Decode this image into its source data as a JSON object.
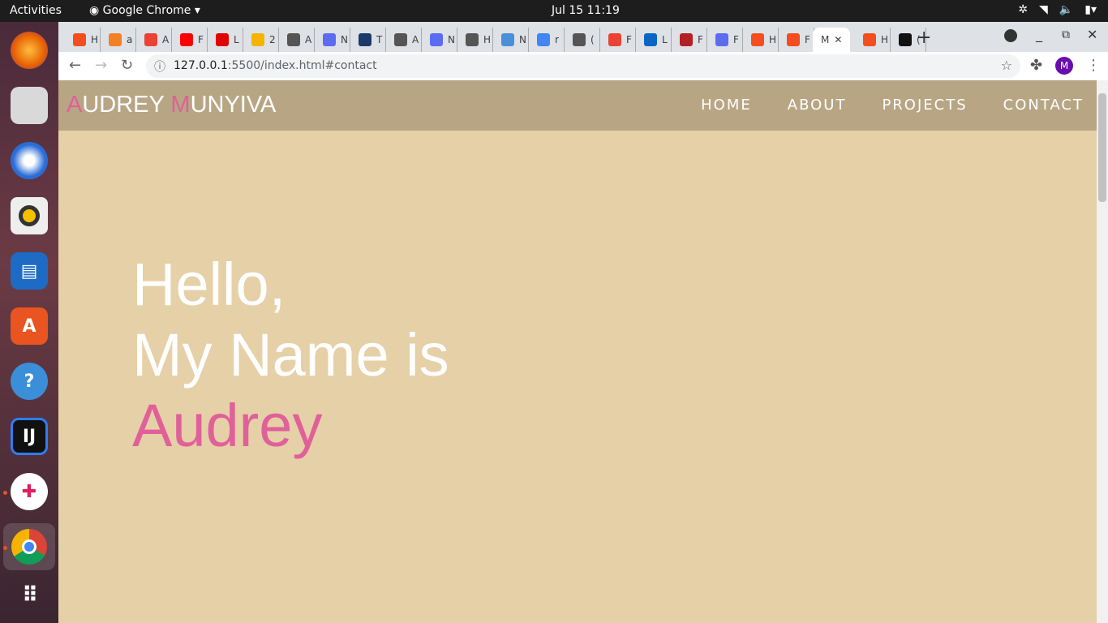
{
  "system": {
    "activities": "Activities",
    "app": "Google Chrome",
    "clock": "Jul 15  11:19"
  },
  "browser": {
    "tabs": [
      {
        "letter": "H",
        "color": "#f24e1e"
      },
      {
        "letter": "a",
        "color": "#f48024"
      },
      {
        "letter": "A",
        "color": "#ea4335"
      },
      {
        "letter": "F",
        "color": "#ff0000"
      },
      {
        "letter": "L",
        "color": "#e00000"
      },
      {
        "letter": "2",
        "color": "#f4b400"
      },
      {
        "letter": "A",
        "color": "#555"
      },
      {
        "letter": "N",
        "color": "#5c6bf0"
      },
      {
        "letter": "T",
        "color": "#1a3a6a"
      },
      {
        "letter": "A",
        "color": "#555"
      },
      {
        "letter": "N",
        "color": "#5c6bf0"
      },
      {
        "letter": "H",
        "color": "#555"
      },
      {
        "letter": "N",
        "color": "#4a90d9"
      },
      {
        "letter": "r",
        "color": "#4285f4"
      },
      {
        "letter": "(",
        "color": "#555"
      },
      {
        "letter": "F",
        "color": "#ea4335"
      },
      {
        "letter": "L",
        "color": "#0a66c2"
      },
      {
        "letter": "F",
        "color": "#b22222"
      },
      {
        "letter": "F",
        "color": "#5c6bf0"
      },
      {
        "letter": "H",
        "color": "#f24e1e"
      },
      {
        "letter": "F",
        "color": "#f24e1e"
      },
      {
        "letter": "M",
        "color": "",
        "active": true
      },
      {
        "letter": "H",
        "color": "#f24e1e"
      },
      {
        "letter": "(",
        "color": "#111"
      }
    ],
    "url_host": "127.0.0.1",
    "url_rest": ":5500/index.html#contact",
    "profile": "M"
  },
  "site": {
    "logo_a": "A",
    "logo_udrey": "UDREY ",
    "logo_m": "M",
    "logo_unyiva": "UNYIVA",
    "nav": [
      "HOME",
      "ABOUT",
      "PROJECTS",
      "CONTACT"
    ],
    "hero": {
      "line1": "Hello,",
      "line2": "My Name is",
      "name": "Audrey"
    }
  }
}
